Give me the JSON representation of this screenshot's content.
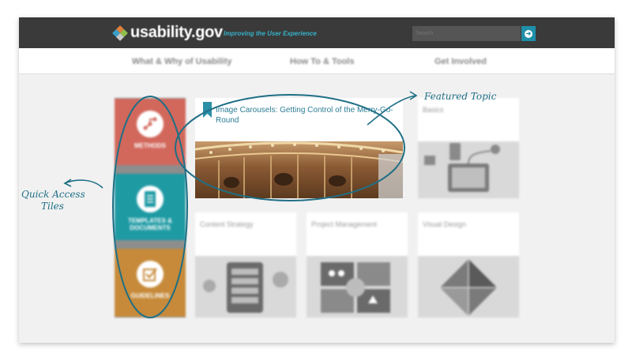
{
  "header": {
    "logo_text": "usability.gov",
    "tagline": "Improving the User Experience",
    "search_placeholder": "Search",
    "search_button_icon": "arrow-right-circle-icon"
  },
  "nav": {
    "items": [
      {
        "label": "What & Why of Usability"
      },
      {
        "label": "How To & Tools"
      },
      {
        "label": "Get Involved"
      }
    ]
  },
  "quick_access": {
    "tiles": [
      {
        "label": "METHODS",
        "icon": "flowchart-icon",
        "color": "#d2675b"
      },
      {
        "label": "TEMPLATES &\nDOCUMENTS",
        "icon": "document-icon",
        "color": "#1e9aa3"
      },
      {
        "label": "GUIDELINES",
        "icon": "checkbox-icon",
        "color": "#c68a3a"
      }
    ]
  },
  "featured": {
    "title": "Image Carousels: Getting Control of the Merry-Go-Round"
  },
  "cards": [
    {
      "title": "Basics"
    },
    {
      "title": "Content Strategy"
    },
    {
      "title": "Project Management"
    },
    {
      "title": "Visual Design"
    }
  ],
  "annotations": {
    "featured_topic": "Featured Topic",
    "quick_access_line1": "Quick Access",
    "quick_access_line2": "Tiles"
  },
  "colors": {
    "header_bg": "#3a3a3a",
    "accent": "#36b0c8",
    "annotation": "#1f6f86"
  }
}
